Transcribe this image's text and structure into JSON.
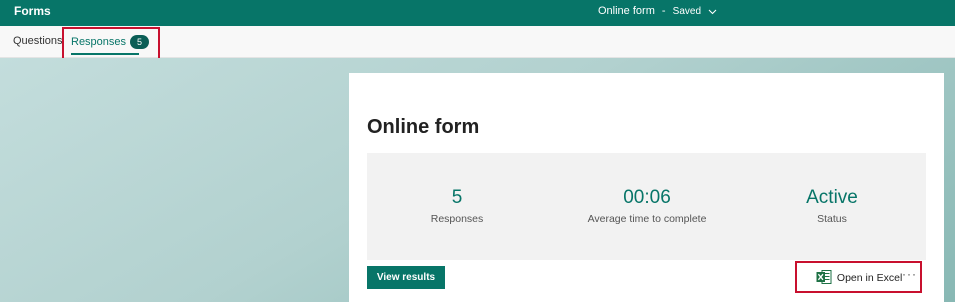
{
  "app": {
    "name": "Forms"
  },
  "document": {
    "title": "Online form",
    "separator": "-",
    "status": "Saved"
  },
  "tabs": {
    "questions": "Questions",
    "responses": "Responses",
    "responses_count": "5"
  },
  "summary": {
    "title": "Online form",
    "stats": [
      {
        "value": "5",
        "label": "Responses"
      },
      {
        "value": "00:06",
        "label": "Average time to complete"
      },
      {
        "value": "Active",
        "label": "Status"
      }
    ]
  },
  "actions": {
    "view_results": "View results",
    "open_excel": "Open in Excel",
    "more": "···"
  },
  "colors": {
    "brand": "#077568",
    "highlight": "#c8102e",
    "badge": "#0b5e56"
  },
  "icons": {
    "excel": "excel-icon",
    "chevron": "chevron-down-icon",
    "more": "more-options-icon"
  }
}
